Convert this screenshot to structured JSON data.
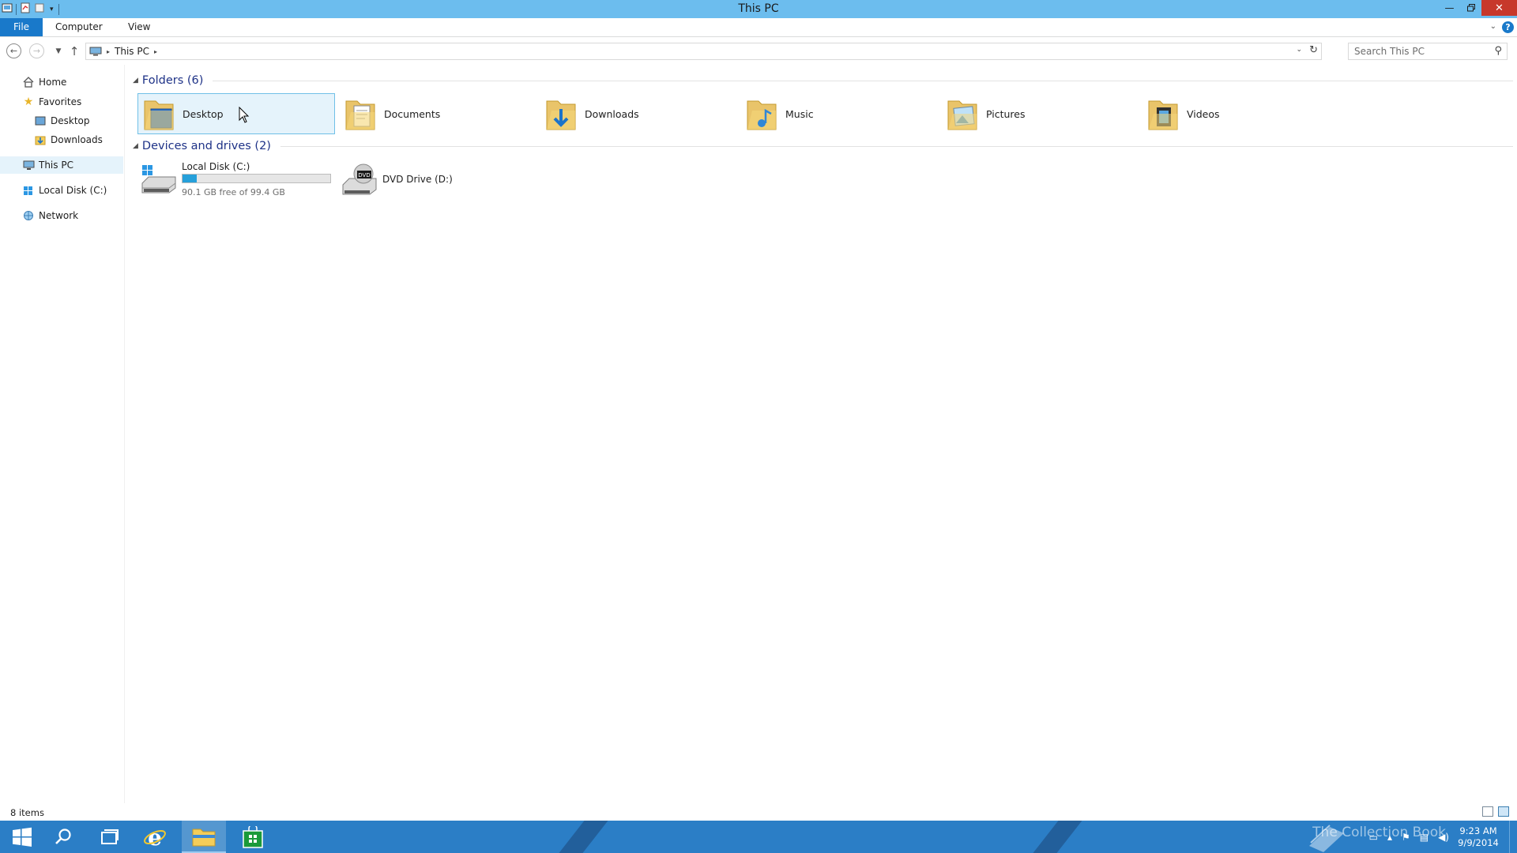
{
  "window": {
    "title": "This PC"
  },
  "ribbon": {
    "tabs": [
      {
        "label": "File"
      },
      {
        "label": "Computer"
      },
      {
        "label": "View"
      }
    ]
  },
  "address": {
    "crumbs": [
      "This PC"
    ],
    "search_placeholder": "Search This PC"
  },
  "nav": {
    "items": [
      {
        "label": "Home",
        "icon": "home-icon"
      },
      {
        "label": "Favorites",
        "icon": "star-icon"
      },
      {
        "label": "Desktop",
        "icon": "desktop-icon"
      },
      {
        "label": "Downloads",
        "icon": "downloads-folder-icon"
      },
      {
        "label": "This PC",
        "icon": "computer-icon",
        "selected": true
      },
      {
        "label": "Local Disk (C:)",
        "icon": "disk-icon"
      },
      {
        "label": "Network",
        "icon": "network-icon"
      }
    ]
  },
  "content": {
    "folders_header": "Folders (6)",
    "folders": [
      {
        "name": "Desktop",
        "icon": "desktop-folder-icon"
      },
      {
        "name": "Documents",
        "icon": "documents-folder-icon"
      },
      {
        "name": "Downloads",
        "icon": "downloads-folder-icon"
      },
      {
        "name": "Music",
        "icon": "music-folder-icon"
      },
      {
        "name": "Pictures",
        "icon": "pictures-folder-icon"
      },
      {
        "name": "Videos",
        "icon": "videos-folder-icon"
      }
    ],
    "devices_header": "Devices and drives (2)",
    "drives": [
      {
        "name": "Local Disk (C:)",
        "free_text": "90.1 GB free of 99.4 GB",
        "used_fraction": 0.094,
        "icon": "local-disk-icon"
      },
      {
        "name": "DVD Drive (D:)",
        "icon": "dvd-drive-icon",
        "icon_text": "DVD"
      }
    ]
  },
  "status": {
    "item_count": "8 items"
  },
  "taskbar": {
    "clock_time": "9:23 AM",
    "clock_date": "9/9/2014",
    "watermark": "The Collection Book"
  },
  "colors": {
    "titlebar": "#6cbdee",
    "file_tab": "#1979ca",
    "taskbar": "#2b7ec6",
    "selection": "#e5f3fb",
    "group_header": "#1e3287",
    "disk_fill": "#26a0da"
  }
}
